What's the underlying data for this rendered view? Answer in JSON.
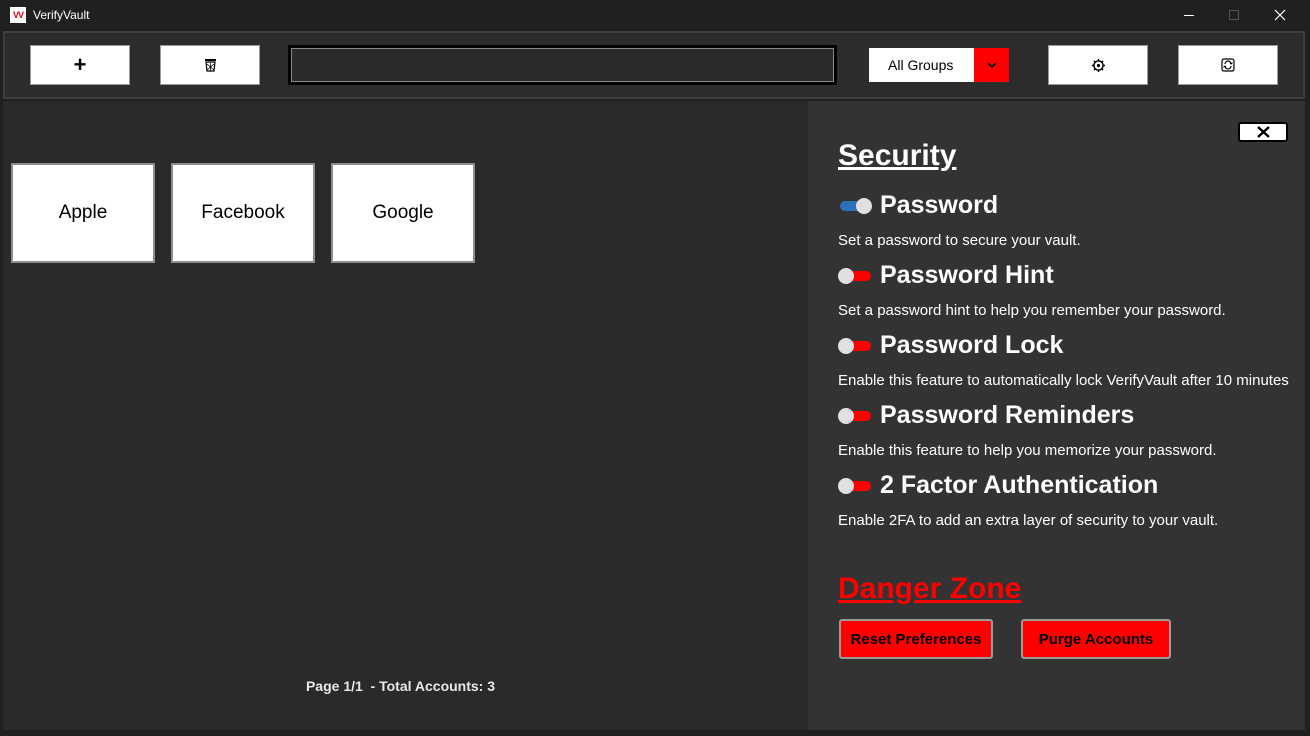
{
  "app": {
    "title": "VerifyVault",
    "logo_text": "VV",
    "accent_color": "#ff0000"
  },
  "window_controls": {
    "minimize_icon": "minimize-icon",
    "maximize_icon": "maximize-icon",
    "close_icon": "close-icon"
  },
  "toolbar": {
    "add_icon": "plus-icon",
    "add_label": "+",
    "delete_icon": "trash-icon",
    "search": {
      "value": "",
      "placeholder": ""
    },
    "group_select": {
      "selected": "All Groups",
      "arrow_icon": "chevron-down-icon"
    },
    "settings_icon": "gear-icon",
    "refresh_icon": "refresh-icon"
  },
  "accounts": [
    {
      "name": "Apple"
    },
    {
      "name": "Facebook"
    },
    {
      "name": "Google"
    }
  ],
  "footer": {
    "page_info": "Page 1/1  - Total Accounts: 3"
  },
  "settings_panel": {
    "close_icon": "close-icon",
    "section_title": "Security",
    "settings": [
      {
        "title": "Password",
        "description": "Set a password to secure your vault.",
        "enabled": true
      },
      {
        "title": "Password Hint",
        "description": "Set a password hint to help you remember your password.",
        "enabled": false
      },
      {
        "title": "Password Lock",
        "description": "Enable this feature to automatically lock VerifyVault after 10 minutes",
        "enabled": false
      },
      {
        "title": "Password Reminders",
        "description": "Enable this feature to help you memorize your password.",
        "enabled": false
      },
      {
        "title": "2 Factor Authentication",
        "description": "Enable 2FA to add an extra layer of security to your vault.",
        "enabled": false
      }
    ],
    "danger_zone": {
      "title": "Danger Zone",
      "reset_label": "Reset Preferences",
      "purge_label": "Purge Accounts"
    }
  }
}
